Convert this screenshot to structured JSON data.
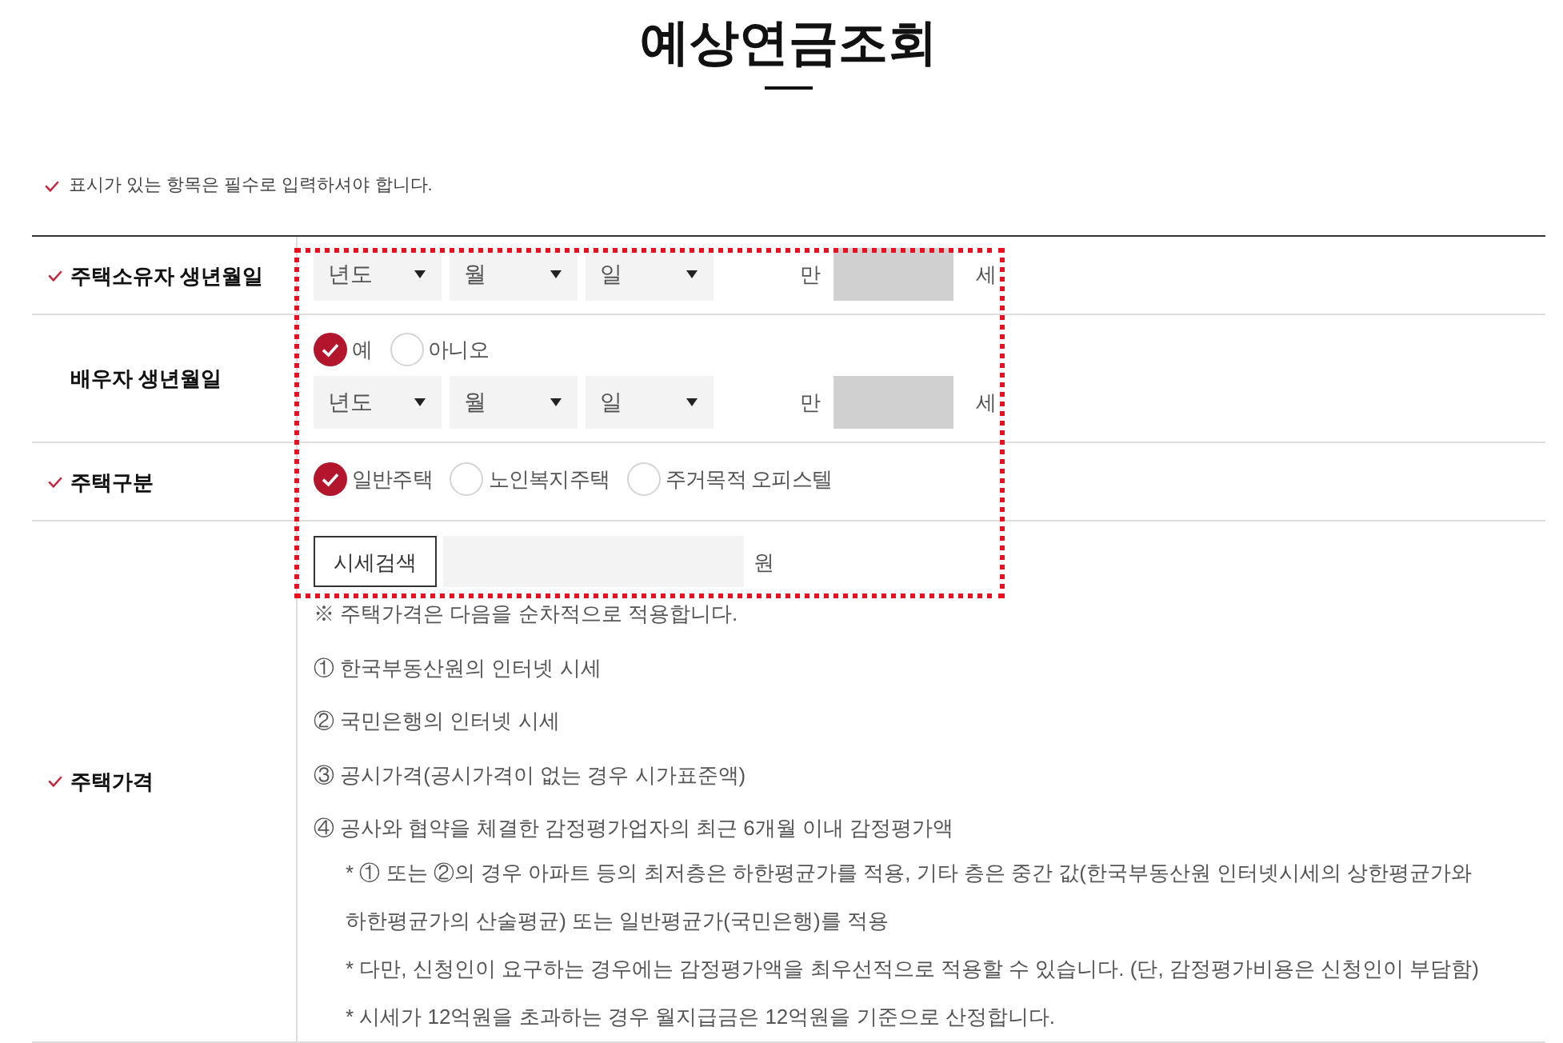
{
  "title": "예상연금조회",
  "required_note": "표시가 있는 항목은 필수로 입력하셔야 합니다.",
  "rows": [
    {
      "label": "주택소유자 생년월일",
      "required": true,
      "fields": [
        {
          "kind": "birthdate",
          "selects": [
            "년도",
            "월",
            "일"
          ],
          "age_prefix": "만",
          "age_suffix": "세"
        }
      ]
    },
    {
      "label": "배우자 생년월일",
      "required": false,
      "fields": [
        {
          "kind": "radios",
          "options": [
            {
              "label": "예",
              "selected": true
            },
            {
              "label": "아니오",
              "selected": false
            }
          ]
        },
        {
          "kind": "birthdate",
          "selects": [
            "년도",
            "월",
            "일"
          ],
          "age_prefix": "만",
          "age_suffix": "세"
        }
      ]
    },
    {
      "label": "주택구분",
      "required": true,
      "fields": [
        {
          "kind": "radios",
          "options": [
            {
              "label": "일반주택",
              "selected": true
            },
            {
              "label": "노인복지주택",
              "selected": false
            },
            {
              "label": "주거목적 오피스텔",
              "selected": false
            }
          ]
        }
      ]
    },
    {
      "label": "주택가격",
      "required": true,
      "fields": [
        {
          "kind": "price",
          "button": "시세검색",
          "unit": "원"
        },
        {
          "kind": "note",
          "text": "※ 주택가격은 다음을 순차적으로 적용합니다."
        },
        {
          "kind": "item",
          "text": "① 한국부동산원의 인터넷 시세"
        },
        {
          "kind": "item",
          "text": "② 국민은행의 인터넷 시세"
        },
        {
          "kind": "item",
          "text": "③ 공시가격(공시가격이 없는 경우 시가표준액)"
        },
        {
          "kind": "item",
          "text": "④ 공사와 협약을 체결한 감정평가업자의 최근 6개월 이내 감정평가액"
        },
        {
          "kind": "subnote",
          "text": "* ① 또는 ②의 경우 아파트 등의 최저층은 하한평균가를 적용, 기타 층은 중간 값(한국부동산원 인터넷시세의 상한평균가와 하한평균가의 산술평균) 또는 일반평균가(국민은행)를 적용"
        },
        {
          "kind": "subnote",
          "text": "* 다만, 신청인이 요구하는 경우에는 감정평가액을 최우선적으로 적용할 수 있습니다. (단, 감정평가비용은 신청인이 부담함)"
        },
        {
          "kind": "subnote",
          "text": "* 시세가 12억원을 초과하는 경우 월지급금은 12억원을 기준으로 산정합니다."
        }
      ]
    }
  ]
}
